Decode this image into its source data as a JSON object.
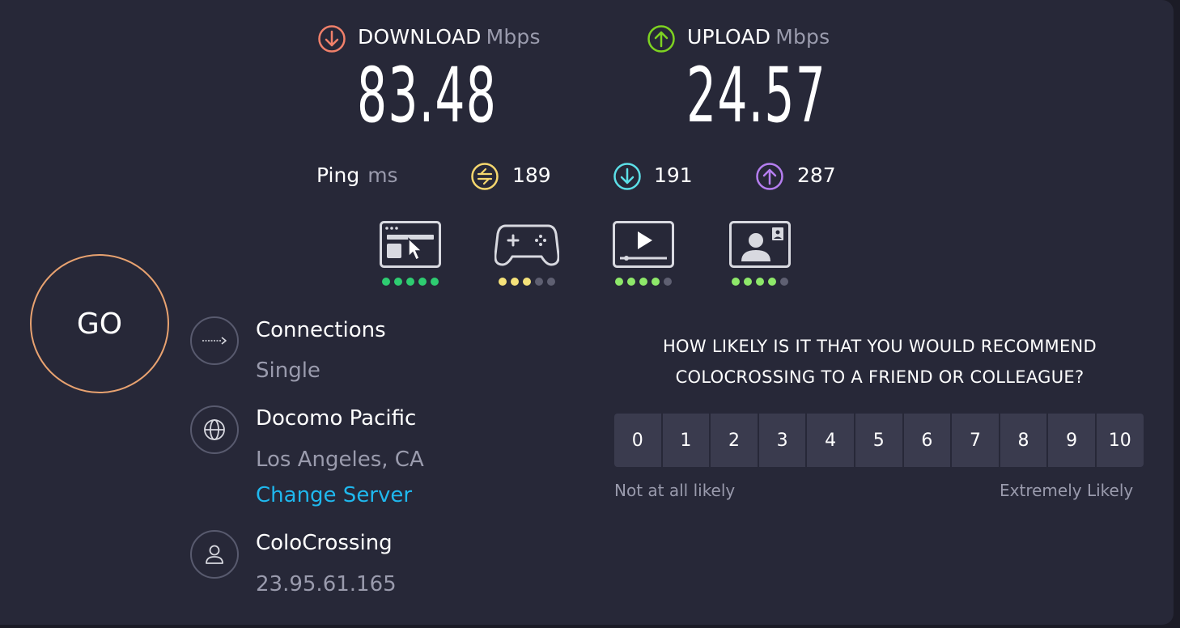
{
  "download": {
    "label": "DOWNLOAD",
    "unit": "Mbps",
    "value": "83.48",
    "icon": "download-arrow-icon",
    "color": "#f0806a"
  },
  "upload": {
    "label": "UPLOAD",
    "unit": "Mbps",
    "value": "24.57",
    "icon": "upload-arrow-icon",
    "color": "#7ed321"
  },
  "ping": {
    "label": "Ping",
    "unit": "ms",
    "idle": {
      "value": "189",
      "color": "#f5d76e"
    },
    "download": {
      "value": "191",
      "color": "#5ce0e8"
    },
    "upload": {
      "value": "287",
      "color": "#b57ef0"
    }
  },
  "quality_ratings": [
    {
      "name": "browsing",
      "icon": "browsing-icon",
      "rating": 5,
      "max": 5,
      "color": "#2ecc71"
    },
    {
      "name": "gaming",
      "icon": "gamepad-icon",
      "rating": 3,
      "max": 5,
      "color": "#f5e27a"
    },
    {
      "name": "streaming",
      "icon": "video-streaming-icon",
      "rating": 4,
      "max": 5,
      "color": "#8ee86a"
    },
    {
      "name": "video-chat",
      "icon": "video-chat-icon",
      "rating": 4,
      "max": 5,
      "color": "#8ee86a"
    }
  ],
  "go_button": {
    "label": "GO"
  },
  "connections": {
    "title": "Connections",
    "value": "Single"
  },
  "server": {
    "title": "Docomo Pacific",
    "location": "Los Angeles, CA",
    "change_link": "Change Server"
  },
  "provider": {
    "title": "ColoCrossing",
    "ip": "23.95.61.165"
  },
  "survey": {
    "question_line1": "HOW LIKELY IS IT THAT YOU WOULD RECOMMEND",
    "question_line2": "COLOCROSSING TO A FRIEND OR COLLEAGUE?",
    "scale": [
      "0",
      "1",
      "2",
      "3",
      "4",
      "5",
      "6",
      "7",
      "8",
      "9",
      "10"
    ],
    "low_label": "Not at all likely",
    "high_label": "Extremely Likely"
  }
}
